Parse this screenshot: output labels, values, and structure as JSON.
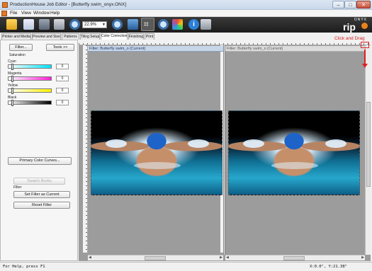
{
  "window": {
    "title": "ProductionHouse Job Editor - [Butterfly swim_onyx.ONX]",
    "min": "–",
    "max": "□",
    "close": "✕"
  },
  "menu": [
    "File",
    "View",
    "Window",
    "Help"
  ],
  "toolbar": {
    "icons": [
      "folder-open-icon",
      "new-document-icon",
      "save-icon",
      "print-icon",
      "zoom-icon",
      "zoom-in-icon",
      "fit-page-icon",
      "crop-icon",
      "zoom-out-icon",
      "color-grid-icon",
      "info-icon",
      "printer-icon"
    ],
    "zoom_value": "22.9%",
    "info_glyph": "i",
    "crop_glyph": "⌗"
  },
  "brand": {
    "onyx": "ONYX",
    "rip": "rip"
  },
  "tabs": [
    "Printer and Media",
    "Preview and Size",
    "Patterns",
    "Tiling Setup",
    "Color Correction",
    "Finishing",
    "Print"
  ],
  "active_tab": "Color Correction",
  "panel": {
    "filter_button": "Filter...",
    "tools_button": "Tools >>",
    "saturation_label": "Saturation",
    "channels": [
      {
        "name": "Cyan",
        "value": "0"
      },
      {
        "name": "Magenta",
        "value": "0"
      },
      {
        "name": "Yellow",
        "value": "0"
      },
      {
        "name": "Black",
        "value": "0"
      }
    ],
    "primary_curves_button": "Primary Color Curves...",
    "swatch_books_button": "Swatch Books",
    "filter_label": "Filter:",
    "set_filter_button": "Set Filter as Current",
    "reset_filter_button": "Reset Filter"
  },
  "viewer": {
    "left_header": "Filter: Butterfly swim_o (Current)",
    "right_header": "Filter: Butterfly swim_o (Current)",
    "image_alt": "Butterfly swimmer photo"
  },
  "annotation": {
    "text": "Click and Drag"
  },
  "status": {
    "help": "For Help, press F1",
    "coords": "X:0.0\", Y:21.38\""
  },
  "colors": {
    "accent": "#e07a2a",
    "callout": "#e02020",
    "header_blue": "#c7d7ea"
  }
}
